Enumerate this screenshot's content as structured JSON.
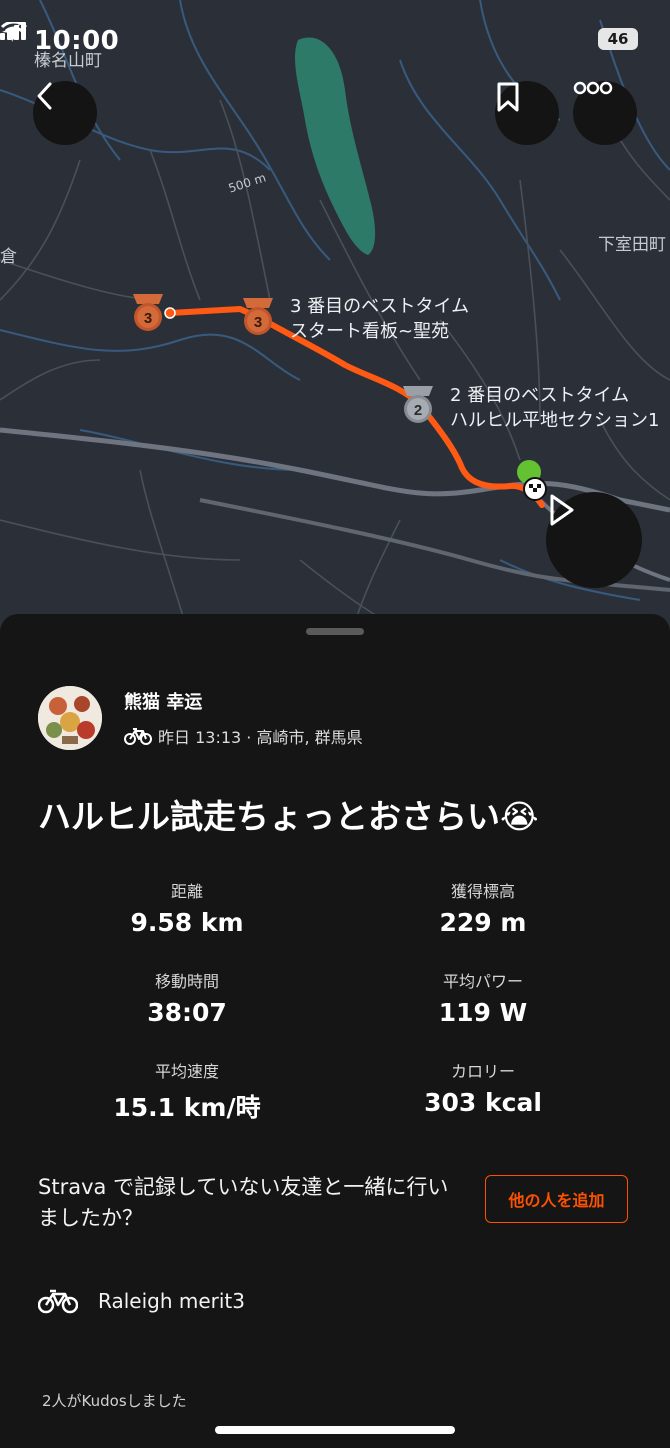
{
  "status_bar": {
    "time": "10:00",
    "battery": "46"
  },
  "map": {
    "place_labels": [
      "榛名山町",
      "下室田町",
      "500 m",
      "倉"
    ],
    "segments": [
      {
        "badge": "3",
        "line1": "3 番目のベストタイム",
        "line2": "スタート看板~聖苑"
      },
      {
        "badge": "2",
        "line1": "2 番目のベストタイム",
        "line2": "ハルヒル平地セクション1"
      }
    ],
    "start_badge": "3"
  },
  "activity": {
    "athlete_name": "熊猫 幸运",
    "meta": "昨日 13:13 · 高崎市, 群馬県",
    "title": "ハルヒル試走ちょっとおさらい😭"
  },
  "stats": [
    {
      "label": "距離",
      "value": "9.58 km"
    },
    {
      "label": "獲得標高",
      "value": "229 m"
    },
    {
      "label": "移動時間",
      "value": "38:07"
    },
    {
      "label": "平均パワー",
      "value": "119 W"
    },
    {
      "label": "平均速度",
      "value": "15.1 km/時"
    },
    {
      "label": "カロリー",
      "value": "303 kcal"
    }
  ],
  "invite": {
    "prompt": "Strava で記録していない友達と一緒に行いましたか？",
    "button": "他の人を追加"
  },
  "gear": {
    "name": "Raleigh merit3"
  },
  "kudos": {
    "text": "2人がKudosしました"
  },
  "colors": {
    "accent": "#fc5200",
    "sheet": "#151515",
    "map_bg": "#2b3038",
    "start_marker": "#63c132"
  }
}
